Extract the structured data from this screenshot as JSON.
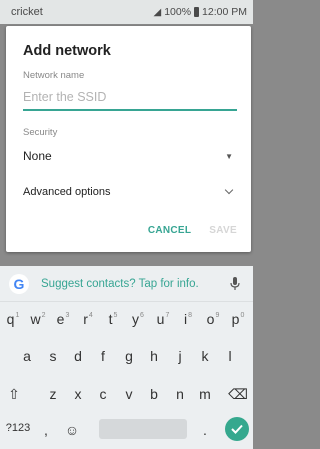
{
  "status_bar": {
    "carrier": "cricket",
    "battery": "100%",
    "time": "12:00 PM"
  },
  "dialog": {
    "title": "Add network",
    "network_name_label": "Network name",
    "ssid_placeholder": "Enter the SSID",
    "ssid_value": "",
    "security_label": "Security",
    "security_value": "None",
    "advanced_label": "Advanced options",
    "cancel_label": "CANCEL",
    "save_label": "SAVE"
  },
  "keyboard": {
    "suggestion": "Suggest contacts? Tap for info.",
    "row1": [
      {
        "key": "q",
        "hint": "1"
      },
      {
        "key": "w",
        "hint": "2"
      },
      {
        "key": "e",
        "hint": "3"
      },
      {
        "key": "r",
        "hint": "4"
      },
      {
        "key": "t",
        "hint": "5"
      },
      {
        "key": "y",
        "hint": "6"
      },
      {
        "key": "u",
        "hint": "7"
      },
      {
        "key": "i",
        "hint": "8"
      },
      {
        "key": "o",
        "hint": "9"
      },
      {
        "key": "p",
        "hint": "0"
      }
    ],
    "row2": [
      "a",
      "s",
      "d",
      "f",
      "g",
      "h",
      "j",
      "k",
      "l"
    ],
    "row3": [
      "z",
      "x",
      "c",
      "v",
      "b",
      "n",
      "m"
    ],
    "symbols_key": "?123",
    "comma_key": ",",
    "period_key": ".",
    "accent_color": "#37a593"
  }
}
